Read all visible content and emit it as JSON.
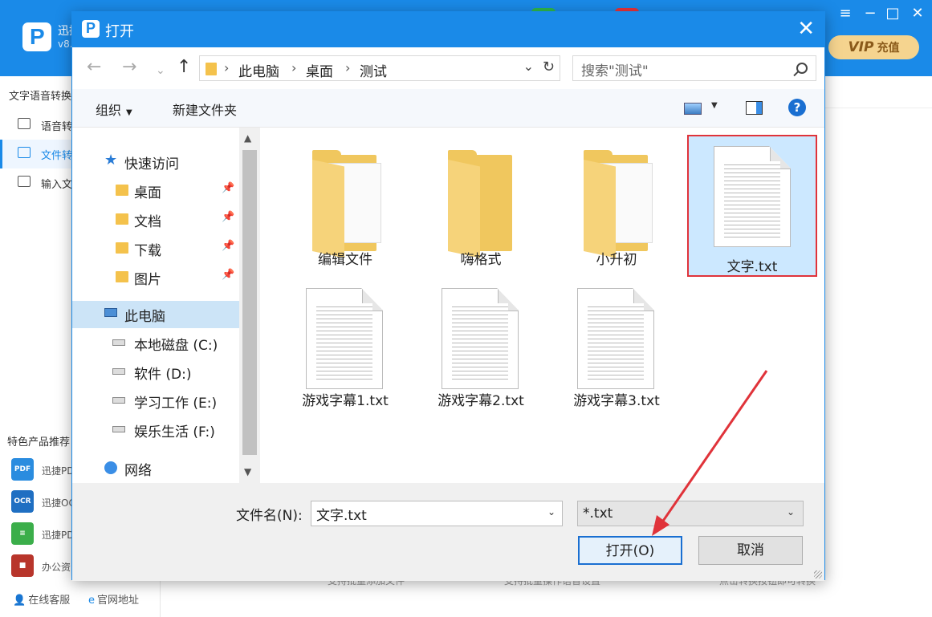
{
  "app": {
    "name": "迅捷",
    "version": "v8.",
    "vip": "VIP",
    "recharge": "充值",
    "window_controls": [
      "≡",
      "−",
      "□",
      "✕"
    ],
    "sidebar": {
      "title": "文字语音转换",
      "items": [
        {
          "label": "语音转"
        },
        {
          "label": "文件转",
          "active": true
        },
        {
          "label": "输入文"
        }
      ],
      "featured_title": "特色产品推荐",
      "products": [
        {
          "label": "迅捷PD",
          "icon": "PDF"
        },
        {
          "label": "迅捷OC",
          "icon": "OCR"
        },
        {
          "label": "迅捷PD",
          "icon": "≡"
        },
        {
          "label": "办公资",
          "icon": "■"
        }
      ],
      "footer": [
        {
          "label": "在线客服",
          "icon": "person-icon"
        },
        {
          "label": "官网地址",
          "icon": "ie-icon"
        }
      ]
    },
    "bottom_text": [
      "支持批量添加文件",
      "支持批量操作语音设置",
      "点击转换按钮即可转换"
    ]
  },
  "dialog": {
    "title": "打开",
    "close": "✕",
    "nav": {
      "back": "←",
      "forward": "→",
      "recent": "⌄",
      "up": "↑"
    },
    "breadcrumb": [
      "此电脑",
      "桌面",
      "测试"
    ],
    "search_placeholder": "搜索\"测试\"",
    "toolbar": {
      "organize": "组织",
      "new_folder": "新建文件夹",
      "help": "?"
    },
    "tree": [
      {
        "label": "快速访问",
        "icon": "star-icon",
        "level": 0
      },
      {
        "label": "桌面",
        "icon": "folder-icon",
        "level": 1,
        "pinned": true
      },
      {
        "label": "文档",
        "icon": "folder-icon",
        "level": 1,
        "pinned": true
      },
      {
        "label": "下载",
        "icon": "folder-icon",
        "level": 1,
        "pinned": true
      },
      {
        "label": "图片",
        "icon": "folder-icon",
        "level": 1,
        "pinned": true
      },
      {
        "label": "此电脑",
        "icon": "computer-icon",
        "level": 0,
        "selected": true
      },
      {
        "label": "本地磁盘 (C:)",
        "icon": "drive-icon",
        "level": 1
      },
      {
        "label": "软件 (D:)",
        "icon": "drive-icon",
        "level": 1
      },
      {
        "label": "学习工作 (E:)",
        "icon": "drive-icon",
        "level": 1
      },
      {
        "label": "娱乐生活 (F:)",
        "icon": "drive-icon",
        "level": 1
      },
      {
        "label": "网络",
        "icon": "network-icon",
        "level": 0
      }
    ],
    "files": [
      {
        "name": "编辑文件",
        "type": "folder"
      },
      {
        "name": "嗨格式",
        "type": "folder"
      },
      {
        "name": "小升初",
        "type": "folder"
      },
      {
        "name": "文字.txt",
        "type": "txt",
        "selected": true
      },
      {
        "name": "游戏字幕1.txt",
        "type": "txt"
      },
      {
        "name": "游戏字幕2.txt",
        "type": "txt"
      },
      {
        "name": "游戏字幕3.txt",
        "type": "txt"
      }
    ],
    "filename_label": "文件名(N):",
    "filename_value": "文字.txt",
    "filetype_value": "*.txt",
    "open_button": "打开(O)",
    "cancel_button": "取消"
  },
  "colors": {
    "accent": "#1a8ae8",
    "highlight": "#e0333a",
    "selection": "#cce8ff"
  }
}
